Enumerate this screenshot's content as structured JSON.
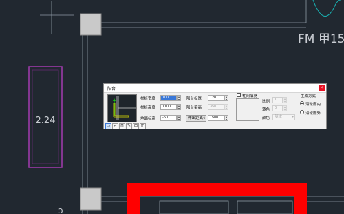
{
  "drawing": {
    "room_size": "2.24",
    "door_label": "FM 甲15"
  },
  "dialog": {
    "title": "阳台",
    "close_glyph": "×",
    "fields": {
      "rail_width": {
        "label": "栏板宽度",
        "value": "100"
      },
      "rail_height": {
        "label": "栏板高度",
        "value": "1100"
      },
      "floor_height": {
        "label": "地面标高",
        "value": "-50"
      },
      "slab_thickness": {
        "label": "阳台板厚",
        "value": "120"
      },
      "balcony_width": {
        "label": "阳台梁高",
        "value": "350"
      },
      "extend_distance": {
        "label": "伸出距离<",
        "value": "1500"
      }
    },
    "fill": {
      "checkbox_label": "柱间填充",
      "scale_label": "比例",
      "scale_value": "1",
      "angle_label": "转角",
      "angle_value": "0",
      "color_label": "颜色",
      "color_value": "随块"
    },
    "generate": {
      "title": "生成方式",
      "option_inner": "沿轮廓内",
      "option_outer": "沿轮廓外",
      "selected": "inner"
    },
    "toolbar": [
      "balcony-straight-icon",
      "balcony-corner-icon",
      "balcony-bay-icon",
      "draw-path-icon",
      "select-wall-icon",
      "pick-icon"
    ]
  }
}
